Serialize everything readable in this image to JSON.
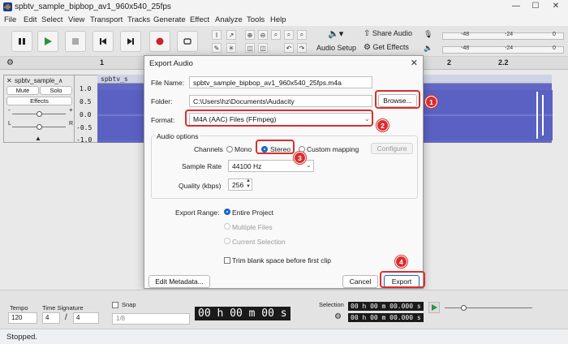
{
  "window": {
    "title": "spbtv_sample_bipbop_av1_960x540_25fps"
  },
  "menu": [
    "File",
    "Edit",
    "Select",
    "View",
    "Transport",
    "Tracks",
    "Generate",
    "Effect",
    "Analyze",
    "Tools",
    "Help"
  ],
  "toolbar": {
    "audio_setup": "Audio Setup",
    "share_audio": "Share Audio",
    "get_effects": "Get Effects",
    "meter_scale_a": [
      "-48",
      "-24",
      "0"
    ],
    "meter_scale_b": [
      "-48",
      "-24",
      "0"
    ]
  },
  "ruler": {
    "marks": [
      "1",
      "2",
      "2.2"
    ]
  },
  "track": {
    "name": "spbtv_sample_∧",
    "mute": "Mute",
    "solo": "Solo",
    "effects": "Effects",
    "gain_minus": "-",
    "gain_plus": "+",
    "pan_left": "L",
    "pan_right": "R",
    "scale": [
      "1.0",
      "0.5",
      "0.0",
      "-0.5",
      "-1.0"
    ],
    "clip_name": "spbtv_s"
  },
  "dialog": {
    "title": "Export Audio",
    "file_name_label": "File Name:",
    "file_name": "spbtv_sample_bipbop_av1_960x540_25fps.m4a",
    "folder_label": "Folder:",
    "folder": "C:\\Users\\hz\\Documents\\Audacity",
    "browse": "Browse...",
    "format_label": "Format:",
    "format": "M4A (AAC) Files (FFmpeg)",
    "audio_options": "Audio options",
    "channels_label": "Channels",
    "mono": "Mono",
    "stereo": "Stereo",
    "custom_mapping": "Custom mapping",
    "configure": "Configure",
    "sample_rate_label": "Sample Rate",
    "sample_rate": "44100 Hz",
    "quality_label": "Quality (kbps)",
    "quality": "256",
    "export_range_label": "Export Range:",
    "entire_project": "Entire Project",
    "multiple_files": "Multiple Files",
    "current_selection": "Current Selection",
    "trim_blank": "Trim blank space before first clip",
    "edit_metadata": "Edit Metadata...",
    "cancel": "Cancel",
    "export": "Export"
  },
  "callouts": [
    "1",
    "2",
    "3",
    "4"
  ],
  "bottom": {
    "tempo_label": "Tempo",
    "tempo": "120",
    "time_signature_label": "Time Signature",
    "ts_num": "4",
    "ts_den": "4",
    "ts_slash": "/",
    "snap_label": "Snap",
    "snap_value": "1/8",
    "time_display": "00 h 00 m 00 s",
    "selection_label": "Selection",
    "sel_start": "00 h 00 m 00.000 s",
    "sel_end": "00 h 00 m 00.000 s"
  },
  "status": {
    "text": "Stopped."
  },
  "colors": {
    "accent": "#1a66c8",
    "callout": "#d82f2f",
    "waveform": "#6268c4",
    "record": "#c8232c"
  }
}
